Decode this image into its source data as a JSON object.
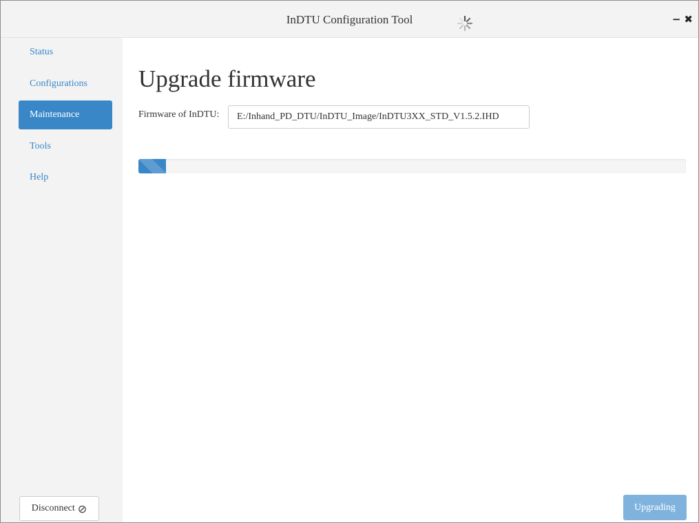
{
  "window": {
    "title": "InDTU Configuration Tool",
    "minimize_glyph": "−",
    "close_glyph": "✖"
  },
  "sidebar": {
    "items": [
      {
        "label": "Status",
        "active": false
      },
      {
        "label": "Configurations",
        "active": false
      },
      {
        "label": "Maintenance",
        "active": true
      },
      {
        "label": "Tools",
        "active": false
      },
      {
        "label": "Help",
        "active": false
      }
    ],
    "disconnect_label": "Disconnect",
    "disconnect_icon": "⊘"
  },
  "main": {
    "title": "Upgrade firmware",
    "firmware_label": "Firmware of InDTU:",
    "firmware_path": "E:/Inhand_PD_DTU/InDTU_Image/InDTU3XX_STD_V1.5.2.IHD",
    "progress_fraction": 0.05,
    "upgrade_button_label": "Upgrading"
  },
  "colors": {
    "accent": "#3a87c8",
    "accent_disabled": "#7fb3de",
    "sidebar_bg": "#f3f3f3"
  }
}
